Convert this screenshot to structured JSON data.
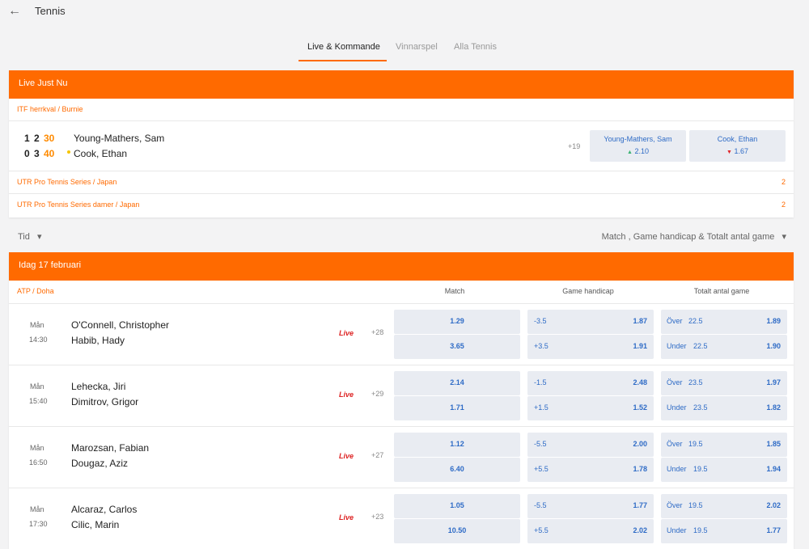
{
  "header": {
    "title": "Tennis",
    "back_icon": "arrow-left-icon"
  },
  "tabs": [
    {
      "label": "Live & Kommande",
      "active": true
    },
    {
      "label": "Vinnarspel",
      "active": false
    },
    {
      "label": "Alla Tennis",
      "active": false
    }
  ],
  "live": {
    "title": "Live Just Nu",
    "leagues": [
      {
        "name": "ITF herrkval / Burnie",
        "match": {
          "p1": {
            "sets": "1",
            "games": "2",
            "points": "30",
            "name": "Young-Mathers, Sam"
          },
          "p2": {
            "sets": "0",
            "games": "3",
            "points": "40",
            "name": "Cook, Ethan"
          },
          "more": "+19",
          "odds": [
            {
              "name": "Young-Mathers, Sam",
              "arrow": "▲",
              "value": "2.10"
            },
            {
              "name": "Cook, Ethan",
              "arrow": "▼",
              "value": "1.67"
            }
          ]
        }
      },
      {
        "name": "UTR Pro Tennis Series / Japan",
        "count": "2"
      },
      {
        "name": "UTR Pro Tennis Series damer / Japan",
        "count": "2"
      }
    ]
  },
  "filters": {
    "left": "Tid",
    "right": "Match , Game handicap & Totalt antal game",
    "chevron": "▾"
  },
  "today": {
    "title": "Idag 17 februari",
    "league": "ATP / Doha",
    "columns": [
      "Match",
      "Game handicap",
      "Totalt antal game"
    ],
    "events": [
      {
        "day": "Mån",
        "time": "14:30",
        "p1": "O'Connell, Christopher",
        "p2": "Habib, Hady",
        "live": "Live",
        "more": "+28",
        "match": [
          "1.29",
          "3.65"
        ],
        "handicap": [
          {
            "line": "-3.5",
            "odds": "1.87"
          },
          {
            "line": "+3.5",
            "odds": "1.91"
          }
        ],
        "total": [
          {
            "label": "Över",
            "line": "22.5",
            "odds": "1.89"
          },
          {
            "label": "Under",
            "line": "22.5",
            "odds": "1.90"
          }
        ]
      },
      {
        "day": "Mån",
        "time": "15:40",
        "p1": "Lehecka, Jiri",
        "p2": "Dimitrov, Grigor",
        "live": "Live",
        "more": "+29",
        "match": [
          "2.14",
          "1.71"
        ],
        "handicap": [
          {
            "line": "-1.5",
            "odds": "2.48"
          },
          {
            "line": "+1.5",
            "odds": "1.52"
          }
        ],
        "total": [
          {
            "label": "Över",
            "line": "23.5",
            "odds": "1.97"
          },
          {
            "label": "Under",
            "line": "23.5",
            "odds": "1.82"
          }
        ]
      },
      {
        "day": "Mån",
        "time": "16:50",
        "p1": "Marozsan, Fabian",
        "p2": "Dougaz, Aziz",
        "live": "Live",
        "more": "+27",
        "match": [
          "1.12",
          "6.40"
        ],
        "handicap": [
          {
            "line": "-5.5",
            "odds": "2.00"
          },
          {
            "line": "+5.5",
            "odds": "1.78"
          }
        ],
        "total": [
          {
            "label": "Över",
            "line": "19.5",
            "odds": "1.85"
          },
          {
            "label": "Under",
            "line": "19.5",
            "odds": "1.94"
          }
        ]
      },
      {
        "day": "Mån",
        "time": "17:30",
        "p1": "Alcaraz, Carlos",
        "p2": "Cilic, Marin",
        "live": "Live",
        "more": "+23",
        "match": [
          "1.05",
          "10.50"
        ],
        "handicap": [
          {
            "line": "-5.5",
            "odds": "1.77"
          },
          {
            "line": "+5.5",
            "odds": "2.02"
          }
        ],
        "total": [
          {
            "label": "Över",
            "line": "19.5",
            "odds": "2.02"
          },
          {
            "label": "Under",
            "line": "19.5",
            "odds": "1.77"
          }
        ]
      }
    ]
  },
  "colors": {
    "accent": "#ff6a00",
    "odds_text": "#2e6bc6",
    "live_red": "#dd2222",
    "odds_bg": "#e9ecf2"
  }
}
